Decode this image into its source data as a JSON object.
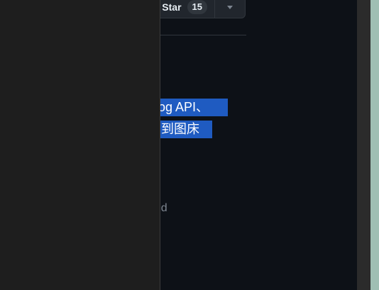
{
  "repo_header": {
    "star_label": "Star",
    "star_count": "15"
  },
  "about": {
    "line1": "blog API、",
    "line2": "到图床",
    "line2_partial_glyph": "占",
    "muted_text": "und"
  },
  "colors": {
    "page_bg": "#0d1117",
    "side_panel_bg": "#1e1e1e",
    "selection": "#1f5bc1",
    "edge_strip": "#9fbfb3"
  }
}
